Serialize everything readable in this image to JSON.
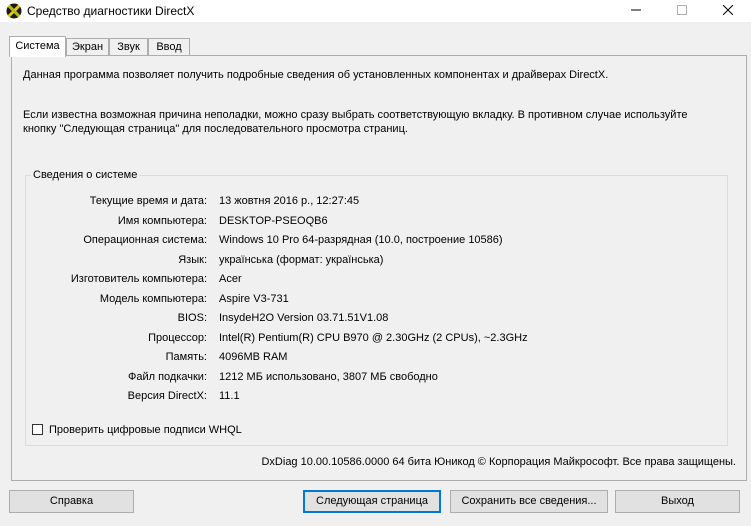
{
  "window": {
    "title": "Средство диагностики DirectX",
    "app_icon": "directx-icon",
    "minimize_icon": "minimize-icon",
    "maximize_icon": "maximize-icon",
    "close_icon": "close-icon"
  },
  "tabs": [
    {
      "label": "Система",
      "active": true
    },
    {
      "label": "Экран",
      "active": false
    },
    {
      "label": "Звук",
      "active": false
    },
    {
      "label": "Ввод",
      "active": false
    }
  ],
  "intro": {
    "line1": "Данная программа позволяет получить подробные сведения об установленных компонентах и драйверах DirectX.",
    "line2": "Если известна возможная причина неполадки, можно сразу выбрать соответствующую вкладку. В противном случае используйте кнопку \"Следующая страница\" для последовательного просмотра страниц."
  },
  "system_info": {
    "title": "Сведения о системе",
    "rows": [
      {
        "label": "Текущие время и дата:",
        "value": "13 жовтня 2016 р., 12:27:45"
      },
      {
        "label": "Имя компьютера:",
        "value": "DESKTOP-PSEOQB6"
      },
      {
        "label": "Операционная система:",
        "value": "Windows 10 Pro 64-разрядная (10.0, построение 10586)"
      },
      {
        "label": "Язык:",
        "value": "українська (формат: українська)"
      },
      {
        "label": "Изготовитель компьютера:",
        "value": "Acer"
      },
      {
        "label": "Модель компьютера:",
        "value": "Aspire V3-731"
      },
      {
        "label": "BIOS:",
        "value": "InsydeH2O Version 03.71.51V1.08"
      },
      {
        "label": "Процессор:",
        "value": "Intel(R) Pentium(R) CPU B970 @ 2.30GHz (2 CPUs), ~2.3GHz"
      },
      {
        "label": "Память:",
        "value": "4096MB RAM"
      },
      {
        "label": "Файл подкачки:",
        "value": "1212 МБ использовано, 3807 МБ свободно"
      },
      {
        "label": "Версия DirectX:",
        "value": "11.1"
      }
    ]
  },
  "whql_checkbox": {
    "label": "Проверить цифровые подписи WHQL",
    "checked": false
  },
  "footer_text": "DxDiag 10.00.10586.0000 64 бита Юникод  © Корпорация Майкрософт. Все права защищены.",
  "buttons": {
    "help": "Справка",
    "next": "Следующая страница",
    "save_all": "Сохранить все сведения...",
    "exit": "Выход"
  }
}
